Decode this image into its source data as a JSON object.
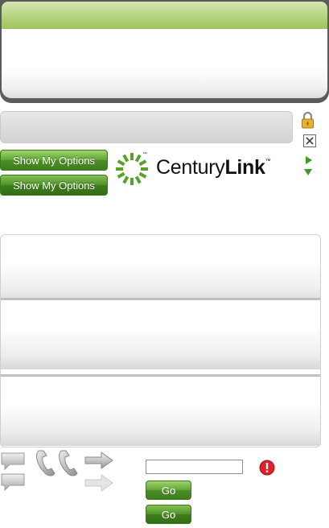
{
  "options": {
    "show_label": "Show My Options",
    "show_label_active": "Show My Options"
  },
  "brand": {
    "name_regular": "Century",
    "name_bold": "Link",
    "trademark": "™"
  },
  "form": {
    "input_value": "",
    "go_label": "Go",
    "go_label_active": "Go"
  },
  "icons": {
    "lock": "lock-icon",
    "close": "close-icon",
    "arrow_right": "play-right-icon",
    "arrow_down": "play-down-icon",
    "chat": "chat-bubble-icon",
    "phone": "phone-icon",
    "forward": "forward-arrow-icon",
    "alert": "alert-icon"
  },
  "colors": {
    "brand_green": "#5ea533",
    "header_green": "#b3d27a",
    "alert_red": "#e0202a"
  }
}
